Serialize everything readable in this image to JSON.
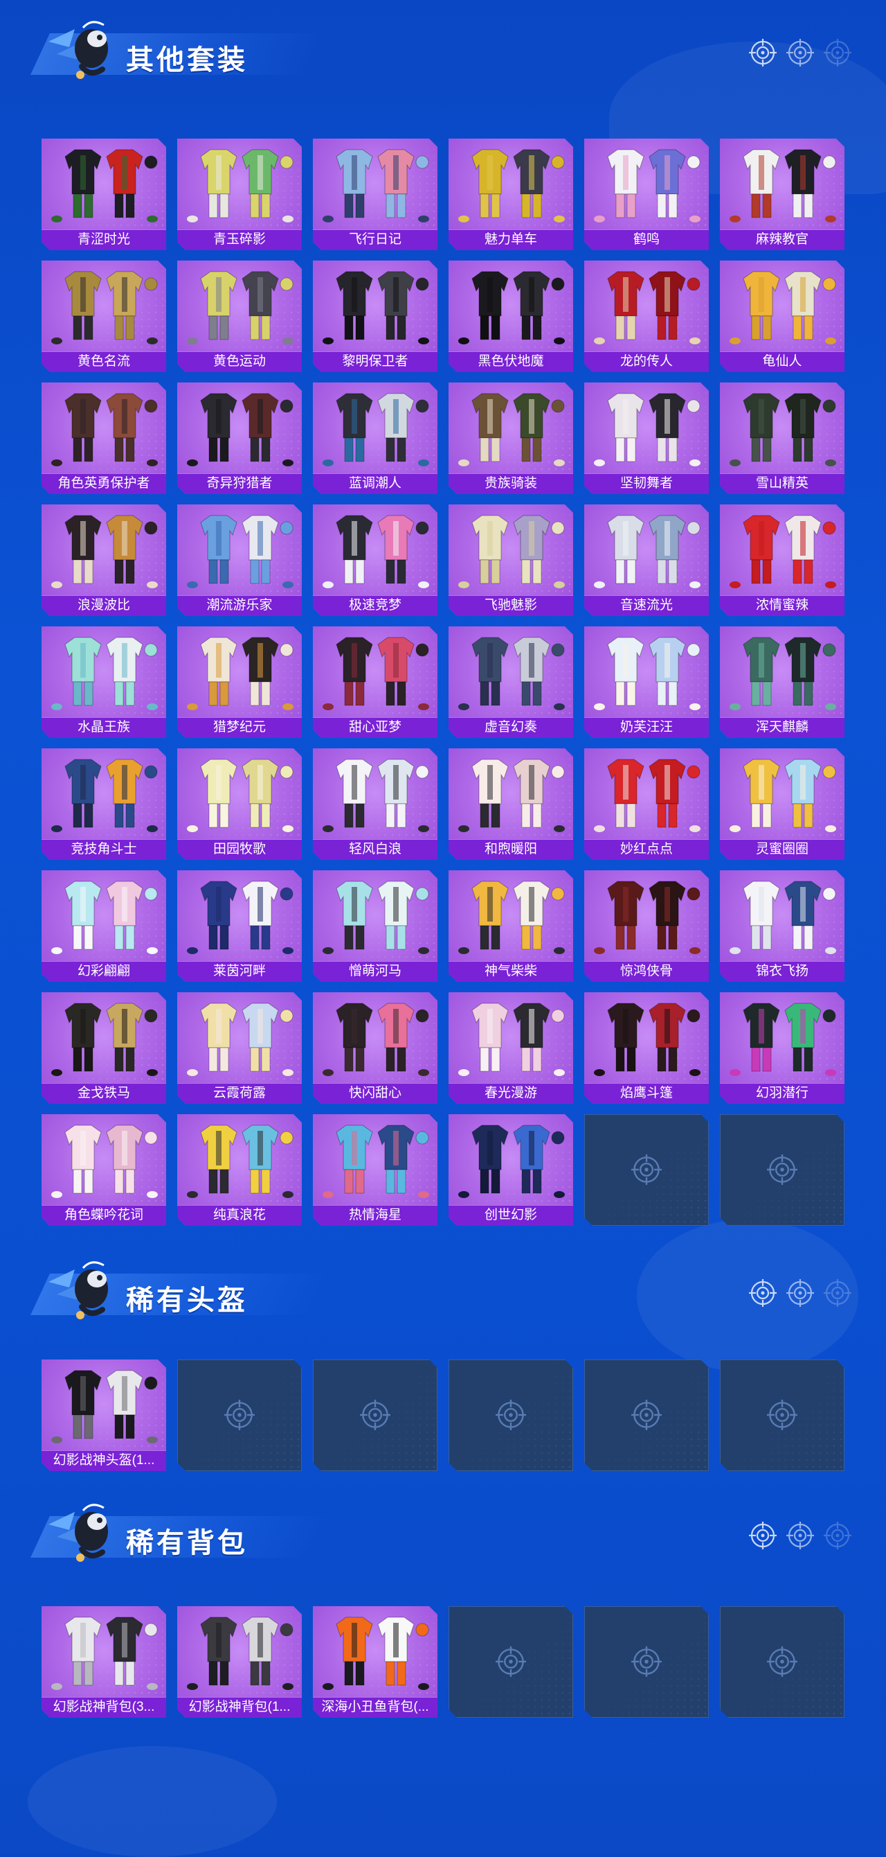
{
  "colors": {
    "background": "#0a4fd0",
    "card_purple": "#b06ae8",
    "label_bar": "#7a22d6",
    "empty_card": "#23406d"
  },
  "icons": {
    "header_mascot": "cartoon-character-icon",
    "header_decoration": "crosshair-target-icon",
    "empty_slot": "crosshair-target-icon"
  },
  "sections": [
    {
      "title": "其他套装",
      "items": [
        {
          "name": "青涩时光",
          "palette": [
            "#1d1d24",
            "#c9231f",
            "#2e6b2f"
          ]
        },
        {
          "name": "青玉碎影",
          "palette": [
            "#d9d56b",
            "#6bb86a",
            "#e7e7e0"
          ]
        },
        {
          "name": "飞行日记",
          "palette": [
            "#8fb7e3",
            "#e58aa6",
            "#2f3f6b"
          ]
        },
        {
          "name": "魅力单车",
          "palette": [
            "#d7b52a",
            "#3a3a4a",
            "#e0c44a"
          ]
        },
        {
          "name": "鹤鸣",
          "palette": [
            "#f2f2f6",
            "#6b6fd6",
            "#e8a0c8"
          ]
        },
        {
          "name": "麻辣教官",
          "palette": [
            "#f0f0f0",
            "#1f1f26",
            "#b23a2a"
          ]
        },
        {
          "name": "黄色名流",
          "palette": [
            "#a88a3f",
            "#c9a75a",
            "#2b2b2b"
          ]
        },
        {
          "name": "黄色运动",
          "palette": [
            "#d8d26a",
            "#44434f",
            "#7e7e8c"
          ]
        },
        {
          "name": "黎明保卫者",
          "palette": [
            "#25252b",
            "#3f3f48",
            "#121216"
          ]
        },
        {
          "name": "黑色伏地魔",
          "palette": [
            "#1a1a1e",
            "#2a2a30",
            "#101012"
          ]
        },
        {
          "name": "龙的传人",
          "palette": [
            "#b71c24",
            "#8e1218",
            "#e6d3b0"
          ]
        },
        {
          "name": "龟仙人",
          "palette": [
            "#f0b43a",
            "#e7e2c9",
            "#d8a030"
          ]
        },
        {
          "name": "角色英勇保护者",
          "palette": [
            "#4a2f2a",
            "#8b4a3a",
            "#2f2226"
          ]
        },
        {
          "name": "奇异狩猎者",
          "palette": [
            "#2a2a30",
            "#5a2a2a",
            "#1a1a1e"
          ]
        },
        {
          "name": "蓝调潮人",
          "palette": [
            "#2e2e38",
            "#d2d8e0",
            "#2b6aa0"
          ]
        },
        {
          "name": "贵族骑装",
          "palette": [
            "#6b5236",
            "#3a4a2a",
            "#e4d9c2"
          ]
        },
        {
          "name": "坚韧舞者",
          "palette": [
            "#e9e3ea",
            "#27272d",
            "#f5f0f3"
          ]
        },
        {
          "name": "雪山精英",
          "palette": [
            "#2e3a2e",
            "#1e261e",
            "#46524a"
          ]
        },
        {
          "name": "浪漫波比",
          "palette": [
            "#2a2226",
            "#c58a3a",
            "#e8dcc8"
          ]
        },
        {
          "name": "潮流游乐家",
          "palette": [
            "#6aa0e0",
            "#e8e8f0",
            "#3a6ab0"
          ]
        },
        {
          "name": "极速竞梦",
          "palette": [
            "#2a2a34",
            "#e87ab8",
            "#f0f0f5"
          ]
        },
        {
          "name": "飞驰魅影",
          "palette": [
            "#e8e2c0",
            "#a8a0c8",
            "#d8cf9a"
          ]
        },
        {
          "name": "音速流光",
          "palette": [
            "#d8dde8",
            "#8fa6c8",
            "#f0f2f6"
          ]
        },
        {
          "name": "浓情蜜辣",
          "palette": [
            "#d8262a",
            "#f0e8e8",
            "#c41c20"
          ]
        },
        {
          "name": "水晶王族",
          "palette": [
            "#9ce0d8",
            "#e8f0f2",
            "#6ab8c8"
          ]
        },
        {
          "name": "猎梦纪元",
          "palette": [
            "#f0e6d8",
            "#2a2424",
            "#d89a3a"
          ]
        },
        {
          "name": "甜心亚梦",
          "palette": [
            "#2a2226",
            "#d84a6a",
            "#8a2a3a"
          ]
        },
        {
          "name": "虚音幻奏",
          "palette": [
            "#3a4a6a",
            "#c8ccd8",
            "#2a3050"
          ]
        },
        {
          "name": "奶芙汪汪",
          "palette": [
            "#e8f0f8",
            "#b8d0f0",
            "#f8f4ea"
          ]
        },
        {
          "name": "浑天麒麟",
          "palette": [
            "#3a6a60",
            "#1e2a2a",
            "#6ab0a0"
          ]
        },
        {
          "name": "竞技角斗士",
          "palette": [
            "#2a4a8a",
            "#e8a030",
            "#1e2a4a"
          ]
        },
        {
          "name": "田园牧歌",
          "palette": [
            "#f0ecb8",
            "#e0d890",
            "#f8f4e0"
          ]
        },
        {
          "name": "轻风白浪",
          "palette": [
            "#f4f4f8",
            "#dfe6f0",
            "#2a2a30"
          ]
        },
        {
          "name": "和煦暖阳",
          "palette": [
            "#f8ece8",
            "#e8d0d0",
            "#2a2a30"
          ]
        },
        {
          "name": "妙红点点",
          "palette": [
            "#d8262a",
            "#c41c20",
            "#f0e0e0"
          ]
        },
        {
          "name": "灵蜜圈圈",
          "palette": [
            "#f0c040",
            "#a8d8f0",
            "#f8f0e0"
          ]
        },
        {
          "name": "幻彩翩翩",
          "palette": [
            "#b8e8f0",
            "#f0c8e0",
            "#f8f8fa"
          ]
        },
        {
          "name": "莱茵河畔",
          "palette": [
            "#2a3a8a",
            "#f4f4f8",
            "#1e2a6a"
          ]
        },
        {
          "name": "憎萌河马",
          "palette": [
            "#a8e0e8",
            "#e8f4f4",
            "#2a2a30"
          ]
        },
        {
          "name": "神气柴柴",
          "palette": [
            "#f0b840",
            "#f4f0e8",
            "#2a2a30"
          ]
        },
        {
          "name": "惊鸿侠骨",
          "palette": [
            "#5a1a1a",
            "#2a1414",
            "#8a2a2a"
          ]
        },
        {
          "name": "锦衣飞扬",
          "palette": [
            "#f4f4f8",
            "#2a4a8a",
            "#dfe4ec"
          ]
        },
        {
          "name": "金戈铁马",
          "palette": [
            "#2a2824",
            "#c8a860",
            "#1a1816"
          ]
        },
        {
          "name": "云霞荷露",
          "palette": [
            "#f0e0a8",
            "#c8d8f0",
            "#f4e8e0"
          ]
        },
        {
          "name": "快闪甜心",
          "palette": [
            "#2a2226",
            "#e8709a",
            "#3a2a30"
          ]
        },
        {
          "name": "春光漫游",
          "palette": [
            "#f0d0e0",
            "#2a2a30",
            "#f8f0f4"
          ]
        },
        {
          "name": "焰鹰斗篷",
          "palette": [
            "#2a1a1e",
            "#a8202a",
            "#1a1214"
          ]
        },
        {
          "name": "幻羽潜行",
          "palette": [
            "#1e2a2a",
            "#3ab87a",
            "#c83ab8"
          ]
        },
        {
          "name": "角色蝶吟花词",
          "palette": [
            "#f8e0e8",
            "#e8b8d0",
            "#f8f4f4"
          ]
        },
        {
          "name": "纯真浪花",
          "palette": [
            "#f0d040",
            "#6ac0e0",
            "#2a2a30"
          ]
        },
        {
          "name": "热情海星",
          "palette": [
            "#5ab8e0",
            "#2a4a8a",
            "#e06a8a"
          ]
        },
        {
          "name": "创世幻影",
          "palette": [
            "#1e2a5a",
            "#3a6ad0",
            "#141a3a"
          ]
        }
      ],
      "empty_slots": 2
    },
    {
      "title": "稀有头盔",
      "items": [
        {
          "name": "幻影战神头盔(1...",
          "palette": [
            "#1a1a1e",
            "#e8e8ec",
            "#6a6a70"
          ]
        }
      ],
      "empty_slots": 5
    },
    {
      "title": "稀有背包",
      "items": [
        {
          "name": "幻影战神背包(3...",
          "palette": [
            "#e8e8ec",
            "#2a2a30",
            "#b8b8c0"
          ]
        },
        {
          "name": "幻影战神背包(1...",
          "palette": [
            "#3a3a40",
            "#d8d8dc",
            "#1e1e22"
          ]
        },
        {
          "name": "深海小丑鱼背包(...",
          "palette": [
            "#f06a1a",
            "#f8f8f8",
            "#1a1a1e"
          ]
        }
      ],
      "empty_slots": 3
    }
  ]
}
